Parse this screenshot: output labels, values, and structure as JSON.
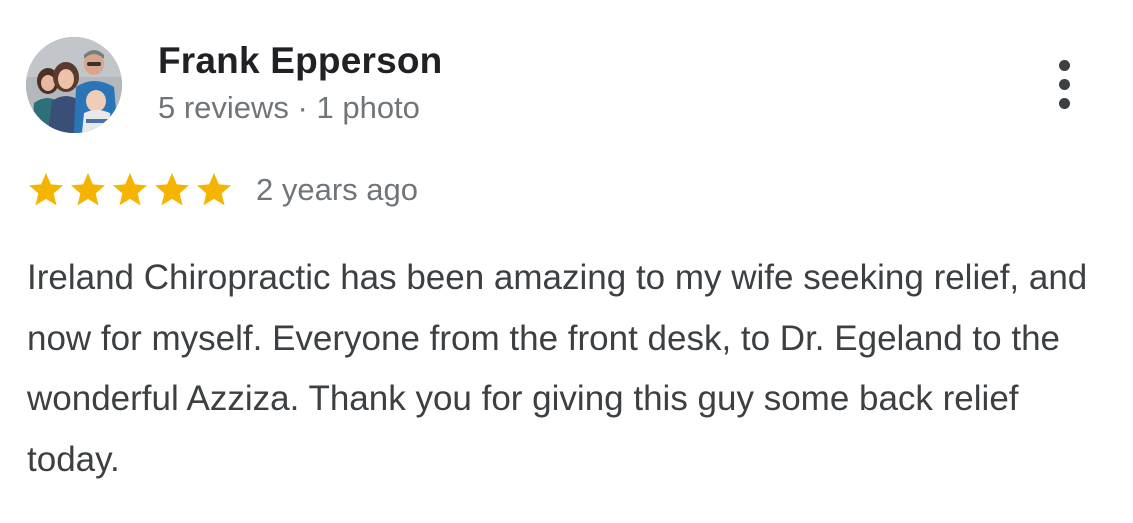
{
  "review": {
    "author": {
      "name": "Frank Epperson",
      "meta": "5 reviews · 1 photo"
    },
    "rating": 5,
    "rating_max": 5,
    "time_ago": "2 years ago",
    "text": "Ireland Chiropractic has been amazing to my wife seeking relief, and now for myself. Everyone from the front desk, to Dr. Egeland to the wonderful Azziza. Thank you for giving this guy some back relief today.",
    "colors": {
      "star": "#f4b400",
      "name": "#202124",
      "meta": "#70757a",
      "body": "#3c4043"
    },
    "icons": {
      "more": "more-vert-icon",
      "star": "star-icon"
    }
  }
}
